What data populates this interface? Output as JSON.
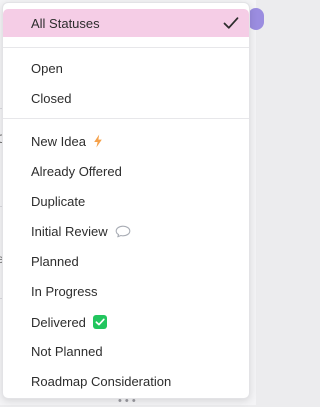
{
  "filter_dropdown": {
    "selected": {
      "label": "All Statuses",
      "icon": "checkmark-icon"
    },
    "group_open_closed": [
      {
        "label": "Open"
      },
      {
        "label": "Closed"
      }
    ],
    "group_statuses": [
      {
        "label": "New Idea",
        "icon": "lightning-bolt-icon",
        "icon_color": "#f5a14b"
      },
      {
        "label": "Already Offered"
      },
      {
        "label": "Duplicate"
      },
      {
        "label": "Initial Review",
        "icon": "speech-bubble-icon",
        "icon_color": "#a9adb5"
      },
      {
        "label": "Planned"
      },
      {
        "label": "In Progress"
      },
      {
        "label": "Delivered",
        "icon": "check-box-icon",
        "icon_color": "#22c55e"
      },
      {
        "label": "Not Planned"
      },
      {
        "label": "Roadmap Consideration"
      }
    ]
  },
  "colors": {
    "selected_background": "#f5cde6",
    "text": "#2d2d2d",
    "divider": "#e7e7ea"
  }
}
